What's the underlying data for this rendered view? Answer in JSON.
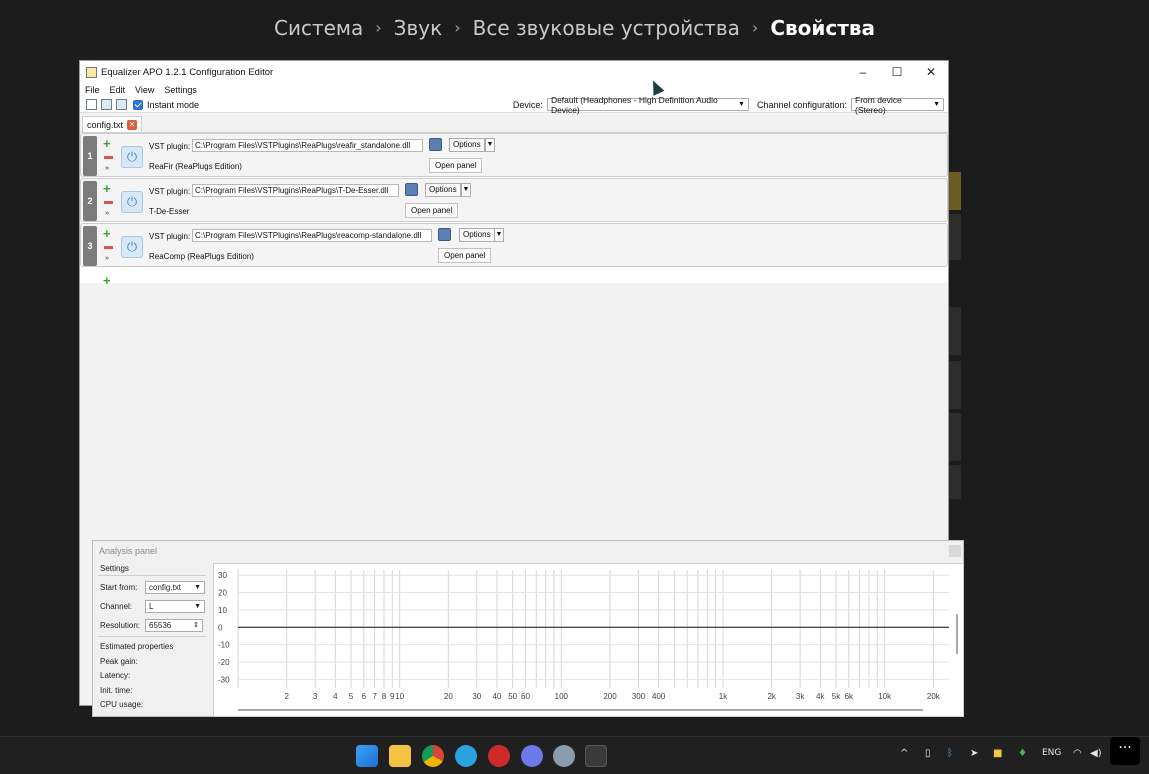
{
  "breadcrumb": {
    "items": [
      "Система",
      "Звук",
      "Все звуковые устройства"
    ],
    "current": "Свойства"
  },
  "window": {
    "title": "Equalizer APO 1.2.1 Configuration Editor",
    "menu": [
      "File",
      "Edit",
      "View",
      "Settings"
    ],
    "instant_mode_label": "Instant mode",
    "instant_mode_checked": true,
    "device_label": "Device:",
    "device_value": "Default (Headphones - High Definition Audio Device)",
    "channel_config_label": "Channel configuration:",
    "channel_config_value": "From device (Stereo)",
    "tab_label": "config.txt",
    "filters": [
      {
        "index": "1",
        "label": "VST plugin:",
        "path": "C:\\Program Files\\VSTPlugins\\ReaPlugs\\reafir_standalone.dll",
        "name": "ReaFir (ReaPlugs Edition)",
        "options_label": "Options",
        "open_panel_label": "Open panel"
      },
      {
        "index": "2",
        "label": "VST plugin:",
        "path": "C:\\Program Files\\VSTPlugins\\ReaPlugs\\T-De-Esser.dll",
        "name": "T-De-Esser",
        "options_label": "Options",
        "open_panel_label": "Open panel"
      },
      {
        "index": "3",
        "label": "VST plugin:",
        "path": "C:\\Program Files\\VSTPlugins\\ReaPlugs\\reacomp-standalone.dll",
        "name": "ReaComp (ReaPlugs Edition)",
        "options_label": "Options",
        "open_panel_label": "Open panel"
      }
    ]
  },
  "analysis": {
    "title": "Analysis panel",
    "settings_heading": "Settings",
    "start_from_label": "Start from:",
    "start_from_value": "config.txt",
    "channel_label": "Channel:",
    "channel_value": "L",
    "resolution_label": "Resolution:",
    "resolution_value": "65536",
    "estimated_heading": "Estimated properties",
    "peak_gain_label": "Peak gain:",
    "latency_label": "Latency:",
    "init_time_label": "Init. time:",
    "cpu_usage_label": "CPU usage:"
  },
  "chart_data": {
    "type": "line",
    "x_scale": "log",
    "xlim": [
      1,
      25000
    ],
    "ylim": [
      -35,
      33
    ],
    "y_ticks": [
      30,
      20,
      10,
      0,
      -10,
      -20,
      -30
    ],
    "x_tick_labels": [
      "2",
      "3",
      "4",
      "5",
      "6",
      "7",
      "8",
      "9",
      "10",
      "20",
      "30",
      "40",
      "50",
      "60",
      "100",
      "200",
      "300",
      "400",
      "1k",
      "2k",
      "3k",
      "4k",
      "5k",
      "6k",
      "10k",
      "20k"
    ],
    "x_tick_values": [
      2,
      3,
      4,
      5,
      6,
      7,
      8,
      9,
      10,
      20,
      30,
      40,
      50,
      60,
      100,
      200,
      300,
      400,
      1000,
      2000,
      3000,
      4000,
      5000,
      6000,
      10000,
      20000
    ],
    "series": [
      {
        "x": [
          1,
          25000
        ],
        "y": [
          0,
          0
        ]
      }
    ],
    "grid": true
  },
  "taskbar": {
    "lang": "ENG",
    "colors": {
      "bg": "#202020"
    }
  }
}
